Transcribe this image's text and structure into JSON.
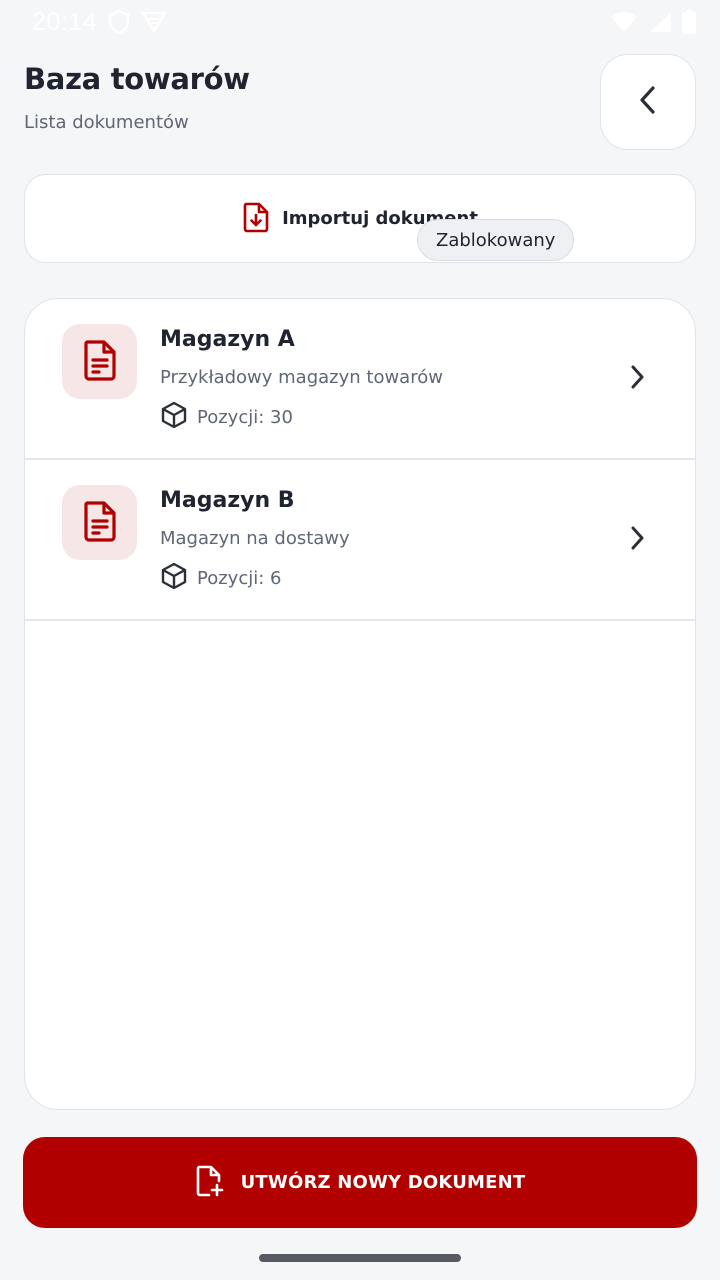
{
  "status_bar": {
    "time": "20:14"
  },
  "header": {
    "title": "Baza towarów",
    "subtitle": "Lista dokumentów"
  },
  "import": {
    "label": "Importuj dokument"
  },
  "documents": [
    {
      "title": "Magazyn A",
      "description": "Przykładowy magazyn towarów",
      "count": "Pozycji: 30"
    },
    {
      "title": "Magazyn B",
      "description": "Magazyn na dostawy",
      "count": "Pozycji: 6",
      "badge": "Zablokowany"
    }
  ],
  "create": {
    "label": "UTWÓRZ NOWY DOKUMENT"
  },
  "colors": {
    "accent": "#b10000",
    "accent_light": "#f7e6e6",
    "background": "#f5f6f8"
  }
}
